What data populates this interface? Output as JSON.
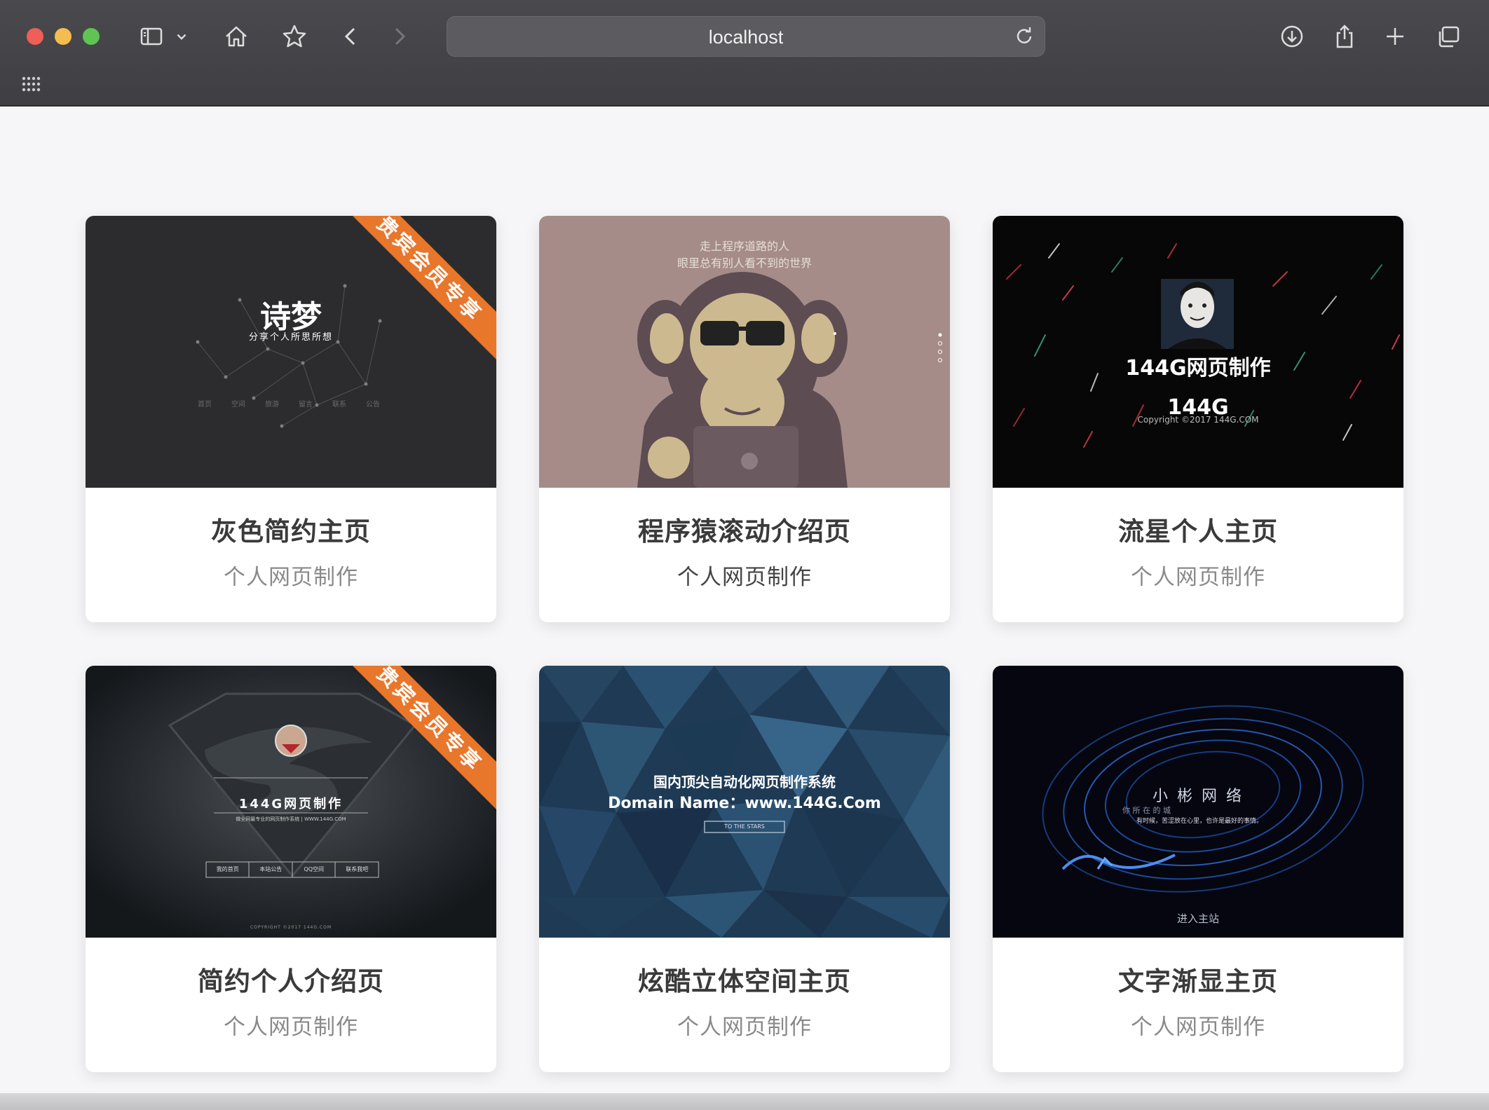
{
  "browser": {
    "url": "localhost",
    "icons": [
      "sidebar-icon",
      "chevron-down-icon",
      "home-icon",
      "star-icon",
      "back-icon",
      "forward-icon",
      "reload-icon",
      "download-icon",
      "share-icon",
      "new-tab-icon",
      "tabs-overview-icon",
      "apps-grid-icon"
    ]
  },
  "ribbon_label": "贵宾会员专享",
  "cards": [
    {
      "title": "灰色简约主页",
      "subtitle": "个人网页制作",
      "thumb": {
        "heading": "诗梦",
        "tagline": "分享个人所思所想",
        "nav": [
          "首页",
          "空间",
          "旅游",
          "留言",
          "联系",
          "公告"
        ]
      }
    },
    {
      "title": "程序猿滚动介绍页",
      "subtitle": "个人网页制作",
      "thumb": {
        "line1": "走上程序道路的人",
        "line2": "眼里总有别人看不到的世界"
      }
    },
    {
      "title": "流星个人主页",
      "subtitle": "个人网页制作",
      "thumb": {
        "heading": "144G网页制作",
        "logo": "144G",
        "copyright": "Copyright   ©2017   144G.COM"
      }
    },
    {
      "title": "简约个人介绍页",
      "subtitle": "个人网页制作",
      "thumb": {
        "heading": "144G网页制作",
        "tagline": "做全网最专业的网页制作系统  |  WWW.144G.COM",
        "nav": [
          "我的首页",
          "本站公告",
          "QQ空间",
          "联系我吧"
        ],
        "copyright": "COPYRIGHT  ©2017  144G.COM"
      }
    },
    {
      "title": "炫酷立体空间主页",
      "subtitle": "个人网页制作",
      "thumb": {
        "line1": "国内顶尖自动化网页制作系统",
        "line2": "Domain Name：www.144G.Com",
        "button": "TO THE STARS"
      }
    },
    {
      "title": "文字渐显主页",
      "subtitle": "个人网页制作",
      "thumb": {
        "heading": "小 彬 网 络",
        "line1": "你 所 在 的 城",
        "line2": "有时候，苦涩放在心里，也许是最好的事情。",
        "link": "进入主站"
      }
    }
  ],
  "colors": {
    "ribbon": "#e8762b",
    "chrome": "#444448",
    "page_bg": "#f6f6f8"
  }
}
